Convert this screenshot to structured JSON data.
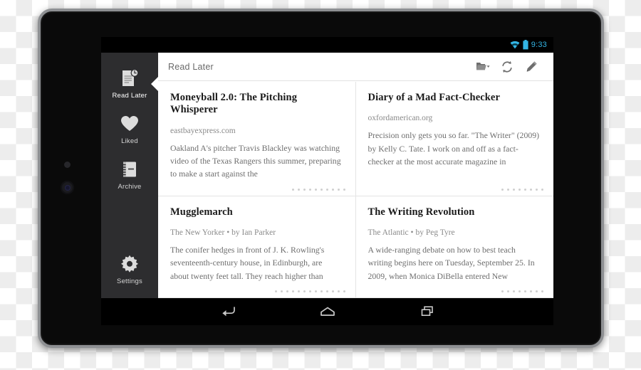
{
  "device": {
    "type": "android-tablet",
    "bezel_color": "#8e9093",
    "body_color": "#0a0a0a"
  },
  "statusbar": {
    "wifi_icon": "wifi-icon",
    "battery_icon": "battery-icon",
    "time": "9:33",
    "accent_color": "#33b5e5"
  },
  "sidebar": {
    "background_color": "#2d2d2f",
    "items": [
      {
        "label": "Read Later",
        "icon": "document-clock-icon",
        "active": true
      },
      {
        "label": "Liked",
        "icon": "heart-icon",
        "active": false
      },
      {
        "label": "Archive",
        "icon": "archive-box-icon",
        "active": false
      },
      {
        "label": "Settings",
        "icon": "gear-icon",
        "active": false
      }
    ]
  },
  "toolbar": {
    "title": "Read Later",
    "actions": [
      {
        "name": "folder-dropdown-icon",
        "label": "Folders"
      },
      {
        "name": "sync-refresh-icon",
        "label": "Sync"
      },
      {
        "name": "pencil-edit-icon",
        "label": "Edit"
      }
    ]
  },
  "articles": [
    {
      "title": "Moneyball 2.0: The Pitching Whisperer",
      "source": "eastbayexpress.com",
      "excerpt": "Oakland A's pitcher Travis Blackley was watching video of the Texas Rangers this summer, preparing to make a start against the",
      "dots": 10
    },
    {
      "title": "Diary of a Mad Fact-Checker",
      "source": "oxfordamerican.org",
      "excerpt": "Precision only gets you so far. \"The Writer\" (2009) by Kelly C. Tate. I work on and off as a fact-checker at the most accurate magazine in",
      "dots": 8
    },
    {
      "title": "Mugglemarch",
      "source": "The New Yorker • by Ian Parker",
      "excerpt": "The conifer hedges in front of J. K. Rowling's seventeenth-century house, in Edinburgh, are about twenty feet tall. They reach higher than",
      "dots": 13
    },
    {
      "title": "The Writing Revolution",
      "source": "The Atlantic • by Peg Tyre",
      "excerpt": "A wide-ranging debate on how to best teach writing begins here on Tuesday, September 25. In 2009, when Monica DiBella entered New",
      "dots": 8
    }
  ],
  "navbar": {
    "buttons": [
      {
        "name": "back-icon",
        "label": "Back"
      },
      {
        "name": "home-icon",
        "label": "Home"
      },
      {
        "name": "recents-icon",
        "label": "Recents"
      }
    ]
  }
}
